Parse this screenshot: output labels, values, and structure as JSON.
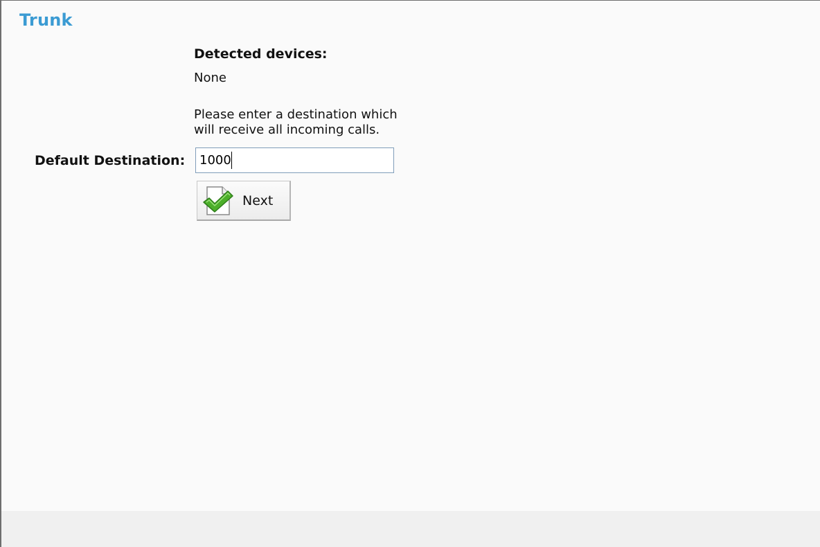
{
  "page": {
    "title": "Trunk"
  },
  "detected": {
    "label": "Detected devices:",
    "value": "None"
  },
  "instructions": "Please enter a destination which\nwill receive all incoming calls.",
  "form": {
    "default_destination_label": "Default Destination:",
    "default_destination_value": "1000"
  },
  "actions": {
    "next_label": "Next",
    "next_icon": "checkmark-document-icon"
  },
  "colors": {
    "title": "#3b9bd3",
    "background": "#fafafa",
    "checkmark": "#4caf2a"
  }
}
